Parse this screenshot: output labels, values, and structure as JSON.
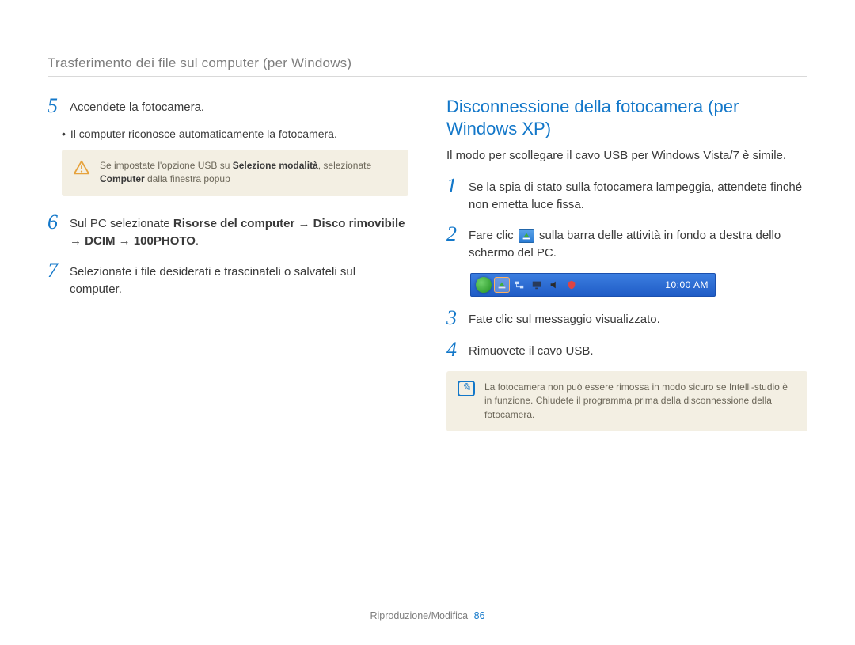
{
  "header": {
    "title": "Trasferimento dei file sul computer (per Windows)"
  },
  "left": {
    "step5": {
      "num": "5",
      "text": "Accendete la fotocamera."
    },
    "step5_bullet": "Il computer riconosce automaticamente la fotocamera.",
    "note5_pre": "Se impostate l'opzione USB su ",
    "note5_bold1": "Selezione modalità",
    "note5_mid": ", selezionate ",
    "note5_bold2": "Computer",
    "note5_post": " dalla finestra popup",
    "step6": {
      "num": "6",
      "pre": "Sul PC selezionate ",
      "bold": "Risorse del computer → Disco rimovibile → DCIM → 100PHOTO",
      "post": "."
    },
    "step7": {
      "num": "7",
      "text": "Selezionate i file desiderati e trascinateli o salvateli sul computer."
    }
  },
  "right": {
    "title": "Disconnessione della fotocamera (per Windows XP)",
    "intro": "Il modo per scollegare il cavo USB per Windows Vista/7 è simile.",
    "step1": {
      "num": "1",
      "text": "Se la spia di stato sulla fotocamera lampeggia, attendete finché non emetta luce fissa."
    },
    "step2": {
      "num": "2",
      "pre": "Fare clic ",
      "post": " sulla barra delle attività in fondo a destra dello schermo del PC."
    },
    "taskbar_clock": "10:00 AM",
    "step3": {
      "num": "3",
      "text": "Fate clic sul messaggio visualizzato."
    },
    "step4": {
      "num": "4",
      "text": "Rimuovete il cavo USB."
    },
    "note_bottom": "La fotocamera non può essere rimossa in modo sicuro se Intelli-studio è in funzione. Chiudete il programma prima della disconnessione della fotocamera."
  },
  "footer": {
    "section": "Riproduzione/Modifica",
    "page": "86"
  }
}
